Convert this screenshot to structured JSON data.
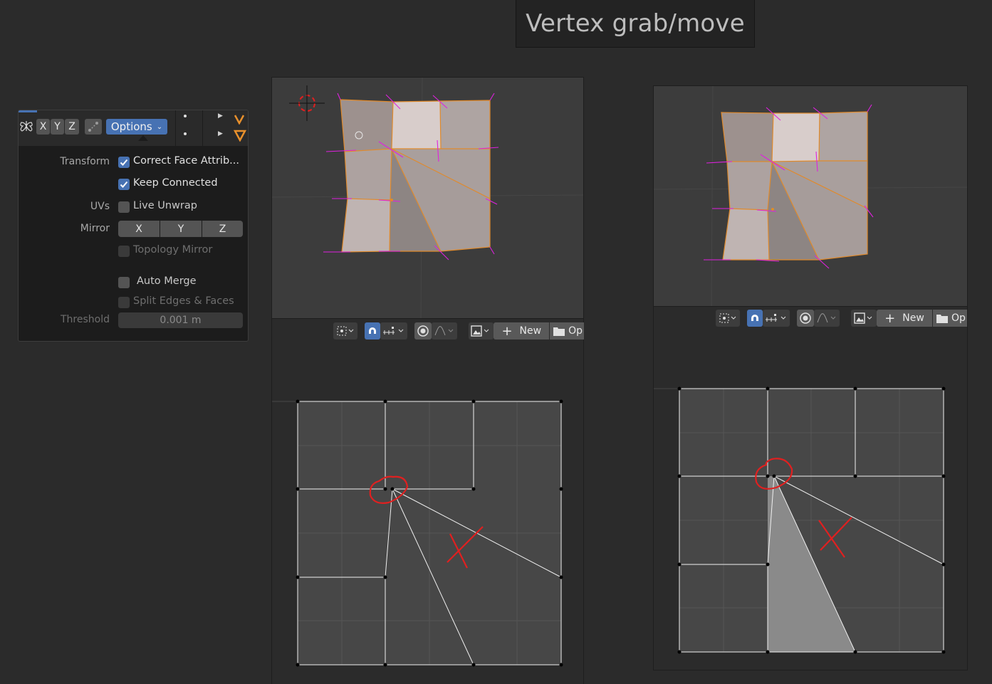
{
  "title": "Vertex grab/move",
  "options_panel": {
    "header": {
      "axes": [
        "X",
        "Y",
        "Z"
      ],
      "options_label": "Options"
    },
    "rows": {
      "transform_label": "Transform",
      "correct_face_label": "Correct Face Attrib...",
      "keep_connected_label": "Keep Connected",
      "uvs_label": "UVs",
      "live_unwrap_label": "Live Unwrap",
      "mirror_label": "Mirror",
      "mirror_axes": [
        "X",
        "Y",
        "Z"
      ],
      "topology_mirror_label": "Topology Mirror",
      "auto_merge_label": "Auto Merge",
      "split_edges_label": "Split Edges & Faces",
      "threshold_label": "Threshold",
      "threshold_value": "0.001 m"
    },
    "checked": {
      "correct_face": true,
      "keep_connected": true,
      "live_unwrap": false,
      "topology_mirror": false,
      "auto_merge": false,
      "split_edges": false
    }
  },
  "uv_toolbar": {
    "new_label": "New",
    "open_label": "Op"
  },
  "colors": {
    "accent": "#4772b3",
    "annotation": "#e02020",
    "mesh_edge": "#e08a2c",
    "normal": "#e020e0"
  }
}
